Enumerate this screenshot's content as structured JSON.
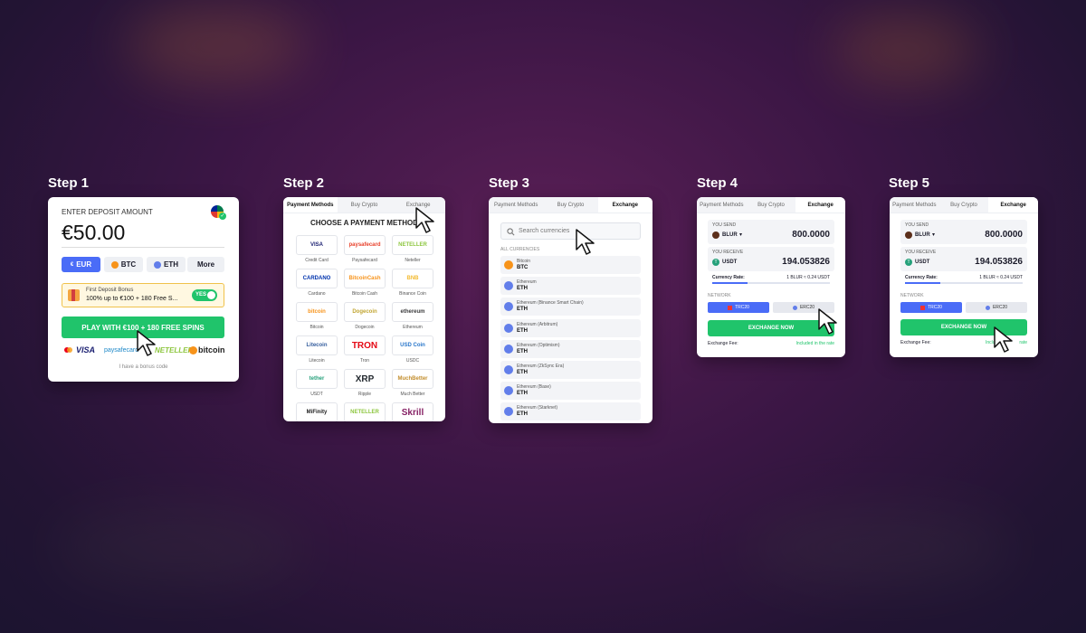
{
  "steps": [
    "Step 1",
    "Step 2",
    "Step 3",
    "Step 4",
    "Step 5"
  ],
  "step1": {
    "title": "ENTER DEPOSIT AMOUNT",
    "amount": "€50.00",
    "currencies": [
      "EUR",
      "BTC",
      "ETH",
      "More"
    ],
    "bonus_title": "First Deposit Bonus",
    "bonus_text": "100% up to €100 + 180 Free S...",
    "toggle": "YES",
    "play_button": "PLAY WITH €100 + 180 FREE SPINS",
    "logos": [
      "VISA",
      "paysafecard",
      "NETELLER",
      "bitcoin"
    ],
    "bonus_code": "I have a bonus code"
  },
  "tabs": [
    "Payment Methods",
    "Buy Crypto",
    "Exchange"
  ],
  "step2": {
    "heading": "CHOOSE A PAYMENT METHOD",
    "methods": [
      {
        "logo": "VISA",
        "label": "Credit Card"
      },
      {
        "logo": "paysafecard",
        "label": "Paysafecard"
      },
      {
        "logo": "NETELLER",
        "label": "Neteller"
      },
      {
        "logo": "CARDANO",
        "label": "Cardano"
      },
      {
        "logo": "BitcoinCash",
        "label": "Bitcoin Cash"
      },
      {
        "logo": "BNB",
        "label": "Binance Coin"
      },
      {
        "logo": "bitcoin",
        "label": "Bitcoin"
      },
      {
        "logo": "Dogecoin",
        "label": "Dogecoin"
      },
      {
        "logo": "ethereum",
        "label": "Ethereum"
      },
      {
        "logo": "Litecoin",
        "label": "Litecoin"
      },
      {
        "logo": "TRON",
        "label": "Tron"
      },
      {
        "logo": "USD Coin",
        "label": "USDC"
      },
      {
        "logo": "tether",
        "label": "USDT"
      },
      {
        "logo": "XRP",
        "label": "Ripple"
      },
      {
        "logo": "MuchBetter",
        "label": "Much Better"
      },
      {
        "logo": "MiFinity",
        "label": ""
      },
      {
        "logo": "NETELLER",
        "label": ""
      },
      {
        "logo": "Skrill",
        "label": ""
      }
    ]
  },
  "step3": {
    "search_placeholder": "Search currencies",
    "section": "ALL CURRENCIES",
    "currencies": [
      {
        "name": "Bitcoin",
        "code": "BTC",
        "color": "#f7931a"
      },
      {
        "name": "Ethereum",
        "code": "ETH",
        "color": "#627eea"
      },
      {
        "name": "Ethereum (Binance Smart Chain)",
        "code": "ETH",
        "color": "#627eea"
      },
      {
        "name": "Ethereum (Arbitrum)",
        "code": "ETH",
        "color": "#627eea"
      },
      {
        "name": "Ethereum (Optimism)",
        "code": "ETH",
        "color": "#627eea"
      },
      {
        "name": "Ethereum (ZkSync Era)",
        "code": "ETH",
        "color": "#627eea"
      },
      {
        "name": "Ethereum (Base)",
        "code": "ETH",
        "color": "#627eea"
      },
      {
        "name": "Ethereum (Starknet)",
        "code": "ETH",
        "color": "#627eea"
      }
    ]
  },
  "exchange": {
    "you_send": "YOU SEND",
    "send_currency": "BLUR",
    "send_amount": "800.0000",
    "you_receive": "YOU RECEIVE",
    "receive_currency": "USDT",
    "receive_amount": "194.053826",
    "rate_label": "Currency Rate:",
    "rate_value": "1 BLUR ≈ 0.24 USDT",
    "network_label": "NETWORK",
    "networks": [
      "TRC20",
      "ERC20"
    ],
    "button": "EXCHANGE NOW",
    "fee_label": "Exchange Fee:",
    "fee_value": "Included in the rate",
    "fee_value_partial": "Includ",
    "fee_value_tail": "rate"
  },
  "colors": {
    "accent_blue": "#4a6cf7",
    "green": "#20c46b",
    "teal_usdt": "#26a17b"
  }
}
